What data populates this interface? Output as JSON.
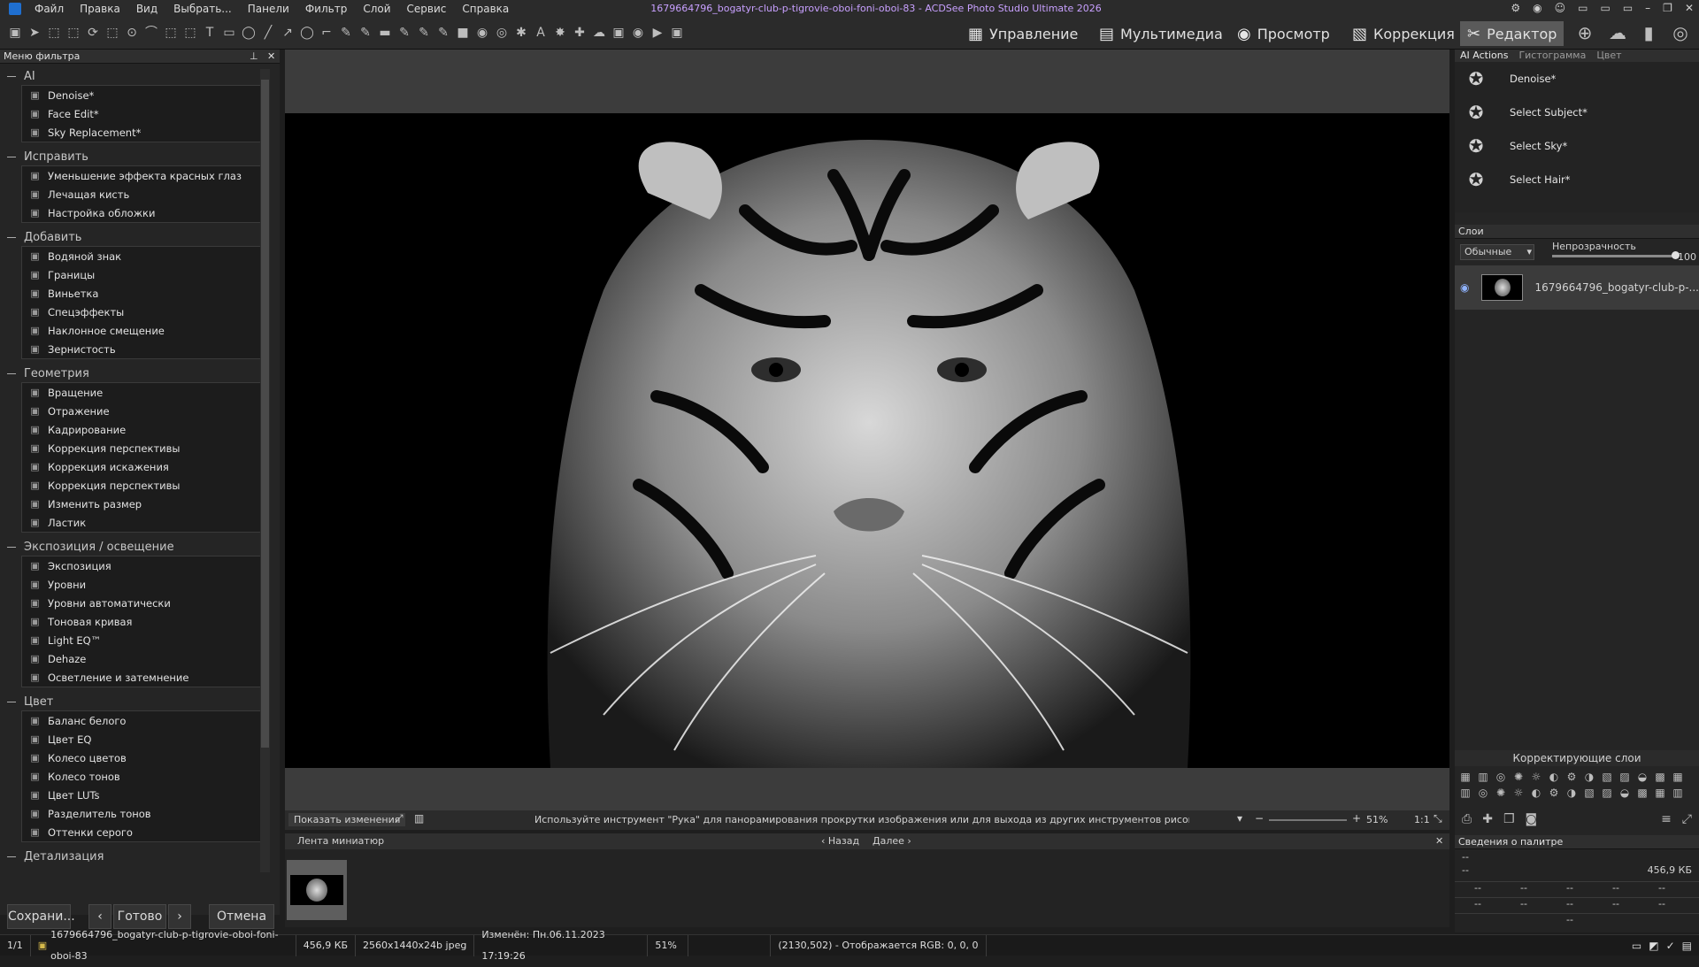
{
  "menu": [
    "Файл",
    "Правка",
    "Вид",
    "Выбрать...",
    "Панели",
    "Фильтр",
    "Слой",
    "Сервис",
    "Справка"
  ],
  "window_title": "1679664796_bogatyr-club-p-tigrovie-oboi-foni-oboi-83 - ACDSee Photo Studio Ultimate 2026",
  "modes": [
    {
      "label": "Управление",
      "icon": "grid-icon"
    },
    {
      "label": "Мультимедиа",
      "icon": "media-icon"
    },
    {
      "label": "Просмотр",
      "icon": "eye-icon"
    },
    {
      "label": "Коррекция",
      "icon": "develop-icon"
    },
    {
      "label": "Редактор",
      "icon": "edit-icon",
      "active": true
    }
  ],
  "left_panel": {
    "title": "Меню фильтра",
    "groups": [
      {
        "title": "AI",
        "items": [
          "Denoise*",
          "Face Edit*",
          "Sky Replacement*"
        ]
      },
      {
        "title": "Исправить",
        "items": [
          "Уменьшение эффекта красных глаз",
          "Лечащая кисть",
          "Настройка обложки"
        ]
      },
      {
        "title": "Добавить",
        "items": [
          "Водяной знак",
          "Границы",
          "Виньетка",
          "Спецэффекты",
          "Наклонное смещение",
          "Зернистость"
        ]
      },
      {
        "title": "Геометрия",
        "items": [
          "Вращение",
          "Отражение",
          "Кадрирование",
          "Коррекция перспективы",
          "Коррекция искажения",
          "Коррекция перспективы",
          "Изменить размер",
          "Ластик"
        ]
      },
      {
        "title": "Экспозиция / освещение",
        "items": [
          "Экспозиция",
          "Уровни",
          "Уровни автоматически",
          "Тоновая кривая",
          "Light EQ™",
          "Dehaze",
          "Осветление и затемнение"
        ]
      },
      {
        "title": "Цвет",
        "items": [
          "Баланс белого",
          "Цвет EQ",
          "Колесо цветов",
          "Колесо тонов",
          "Цвет LUTs",
          "Разделитель тонов",
          "Оттенки серого"
        ]
      },
      {
        "title": "Детализация",
        "items": []
      }
    ],
    "buttons": {
      "save": "Сохрани...",
      "done": "Готово",
      "cancel": "Отмена"
    }
  },
  "canvas": {
    "show_changes": "Показать изменения",
    "hint": "Используйте инструмент \"Рука\" для панорамирования прокрутки изображения или для выхода из других инструментов рисования или вы...",
    "zoom": "51%",
    "one_to_one": "1:1"
  },
  "filmstrip": {
    "title": "Лента миниатюр",
    "back": "Назад",
    "next": "Далее"
  },
  "right_panel": {
    "tabs": [
      "AI Actions",
      "Гистограмма",
      "Цвет"
    ],
    "ai_actions": [
      "Denoise*",
      "Select Subject*",
      "Select Sky*",
      "Select Hair*"
    ],
    "layers_title": "Слои",
    "blend_mode": "Обычные",
    "opacity_label": "Непрозрачность",
    "opacity_value": "100",
    "layer_name": "1679664796_bogatyr-club-p-...",
    "adjust_title": "Корректирующие слои",
    "palette_title": "Сведения о палитре",
    "palette_size": "456,9 КБ",
    "palette_dash": "--"
  },
  "statusbar": {
    "index": "1/1",
    "filename": "1679664796_bogatyr-club-p-tigrovie-oboi-foni-oboi-83",
    "size": "456,9 КБ",
    "dims": "2560x1440x24b jpeg",
    "modified": "Изменён: Пн.06.11.2023 17:19:26",
    "zoom": "51%",
    "coords": "(2130,502) - Отображается RGB: 0, 0, 0"
  }
}
